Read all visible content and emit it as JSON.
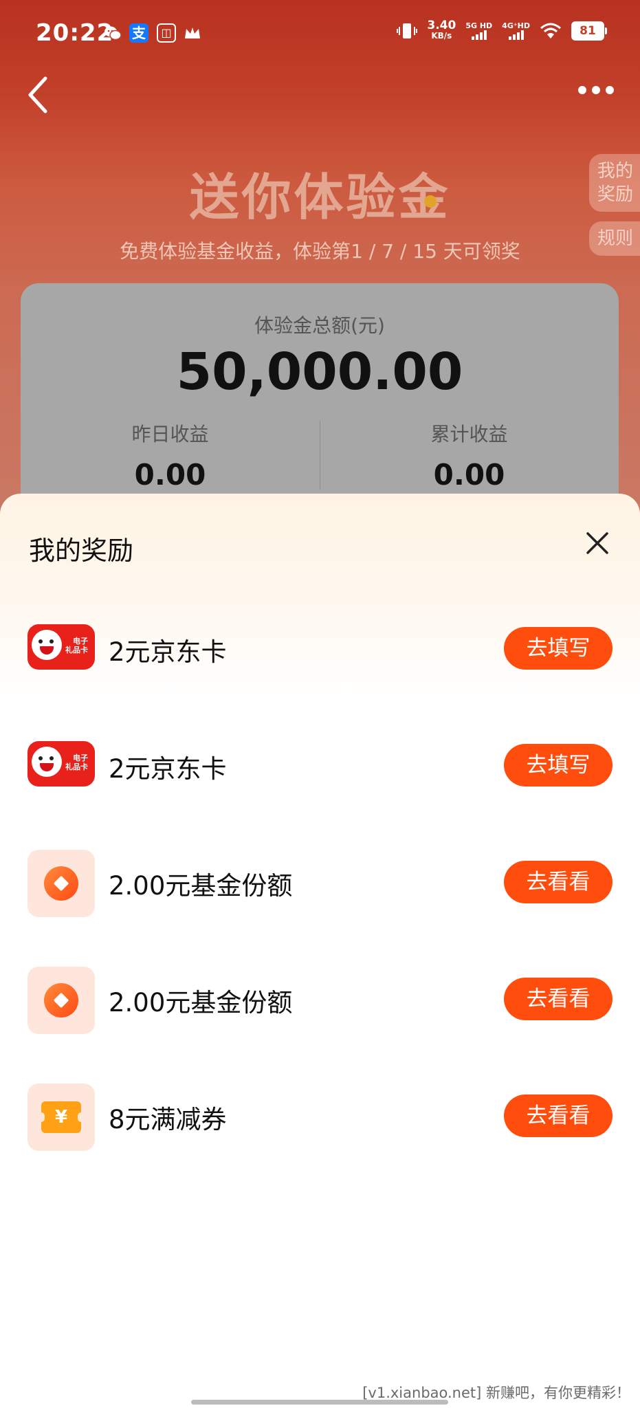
{
  "status": {
    "time": "20:22",
    "net_speed_value": "3.40",
    "net_speed_unit": "KB/s",
    "sim1": "5G HD",
    "sim2": "4G⁺HD",
    "battery": "81"
  },
  "header": {
    "title": "送你体验金",
    "subtitle": "免费体验基金收益，体验第1 / 7 / 15 天可领奖",
    "side_my_rewards": [
      "我的",
      "奖励"
    ],
    "side_rules": "规则"
  },
  "summary": {
    "total_label": "体验金总额(元)",
    "total_value": "50,000.00",
    "yesterday_label": "昨日收益",
    "yesterday_value": "0.00",
    "cumulative_label": "累计收益",
    "cumulative_value": "0.00"
  },
  "sheet": {
    "title": "我的奖励",
    "jd_card_text": [
      "电子",
      "礼品卡"
    ],
    "rewards": [
      {
        "name": "2元京东卡",
        "action": "去填写",
        "icon": "jd-gift-card-icon"
      },
      {
        "name": "2元京东卡",
        "action": "去填写",
        "icon": "jd-gift-card-icon"
      },
      {
        "name": "2.00元基金份额",
        "action": "去看看",
        "icon": "fund-coin-icon"
      },
      {
        "name": "2.00元基金份额",
        "action": "去看看",
        "icon": "fund-coin-icon"
      },
      {
        "name": "8元满减券",
        "action": "去看看",
        "icon": "coupon-icon",
        "icon_symbol": "¥"
      }
    ]
  },
  "watermark": "[v1.xianbao.net] 新赚吧，有你更精彩！",
  "colors": {
    "accent": "#ff4d0d",
    "header_bg": "#c2402a",
    "card_bg": "#a7a7a7"
  }
}
